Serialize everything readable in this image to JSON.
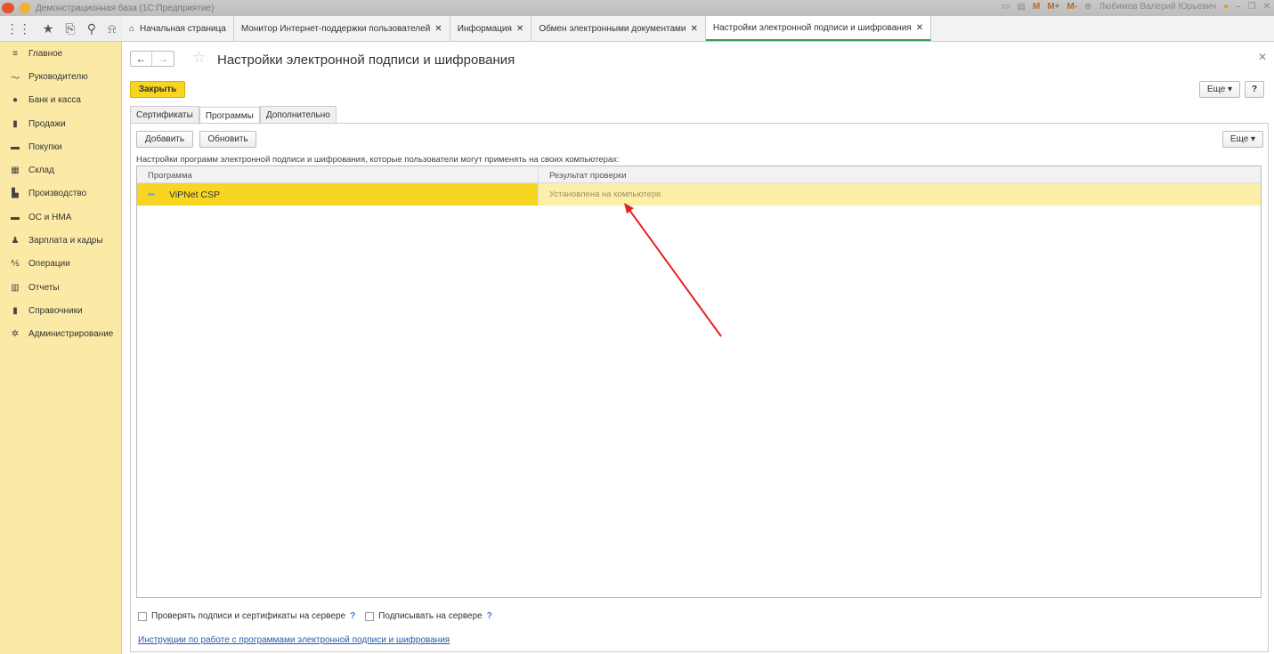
{
  "window": {
    "title": "Демонстрационная база (1С:Предприятие)",
    "user": "Любимов Валерий Юрьевич",
    "mem_buttons": [
      "M",
      "M+",
      "M-"
    ]
  },
  "tabs": [
    {
      "label": "Начальная страница",
      "closable": false
    },
    {
      "label": "Монитор Интернет-поддержки пользователей",
      "closable": true
    },
    {
      "label": "Информация",
      "closable": true
    },
    {
      "label": "Обмен электронными документами",
      "closable": true
    },
    {
      "label": "Настройки электронной подписи и шифрования",
      "closable": true,
      "active": true
    }
  ],
  "sidebar": [
    {
      "icon": "menu-icon",
      "glyph": "≡",
      "label": "Главное"
    },
    {
      "icon": "chart-line-icon",
      "glyph": "〜",
      "label": "Руководителю"
    },
    {
      "icon": "bank-icon",
      "glyph": "●",
      "label": "Банк и касса"
    },
    {
      "icon": "bag-icon",
      "glyph": "▮",
      "label": "Продажи"
    },
    {
      "icon": "cart-icon",
      "glyph": "▬",
      "label": "Покупки"
    },
    {
      "icon": "warehouse-icon",
      "glyph": "▦",
      "label": "Склад"
    },
    {
      "icon": "factory-icon",
      "glyph": "▙",
      "label": "Производство"
    },
    {
      "icon": "truck-icon",
      "glyph": "▬",
      "label": "ОС и НМА"
    },
    {
      "icon": "person-icon",
      "glyph": "♟",
      "label": "Зарплата и кадры"
    },
    {
      "icon": "operations-icon",
      "glyph": "⅍",
      "label": "Операции"
    },
    {
      "icon": "reports-icon",
      "glyph": "▥",
      "label": "Отчеты"
    },
    {
      "icon": "book-icon",
      "glyph": "▮",
      "label": "Справочники"
    },
    {
      "icon": "gear-icon",
      "glyph": "✲",
      "label": "Администрирование"
    }
  ],
  "page": {
    "title": "Настройки электронной подписи и шифрования",
    "close_label": "Закрыть",
    "more_label": "Еще ▾",
    "help_label": "?"
  },
  "form_tabs": [
    "Сертификаты",
    "Программы",
    "Дополнительно"
  ],
  "panel": {
    "add_label": "Добавить",
    "refresh_label": "Обновить",
    "more_label": "Еще ▾",
    "description": "Настройки программ электронной подписи и шифрования, которые пользователи могут применять на своих компьютерах:",
    "columns": [
      "Программа",
      "Результат проверки"
    ],
    "rows": [
      {
        "program": "ViPNet CSP",
        "result": "Установлена на компьютере."
      }
    ],
    "check_server": "Проверять подписи и сертификаты на сервере",
    "sign_server": "Подписывать на сервере",
    "help": "?",
    "link": "Инструкции по работе с программами электронной подписи и шифрования"
  },
  "colors": {
    "accent": "#f7d520",
    "sidebar": "#fbeaa5",
    "annotation": "#e82020"
  }
}
